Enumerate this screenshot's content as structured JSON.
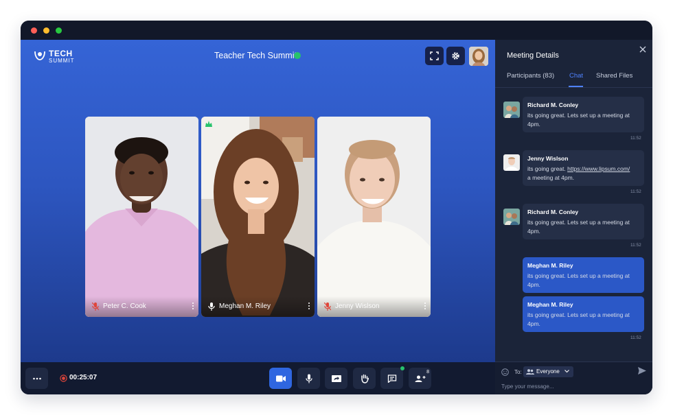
{
  "app": {
    "logo_line1": "TECH",
    "logo_line2": "SUMMIT",
    "meeting_title": "Teacher Tech Summit"
  },
  "participants_on_stage": [
    {
      "name": "Peter C. Cook",
      "mic": "muted"
    },
    {
      "name": "Meghan M. Riley",
      "mic": "on",
      "speaking": true
    },
    {
      "name": "Jenny Wislson",
      "mic": "muted"
    }
  ],
  "controls": {
    "timer": "00:25:07",
    "participants_badge": "8"
  },
  "panel": {
    "title": "Meeting Details",
    "tabs": [
      {
        "label": "Participants (83)",
        "active": false
      },
      {
        "label": "Chat",
        "active": true
      },
      {
        "label": "Shared Files",
        "active": false
      }
    ],
    "messages": [
      {
        "sender": "Richard M. Conley",
        "text": "its going great. Lets set up a meeting at 4pm.",
        "time": "11:52",
        "direction": "in"
      },
      {
        "sender": "Jenny Wislson",
        "text_before": "its going great. ",
        "link": "https://www.lipsum.com/",
        "text_after": "a meeting at 4pm.",
        "time": "11:52",
        "direction": "in"
      },
      {
        "sender": "Richard M. Conley",
        "text": "its going great. Lets set up a meeting at 4pm.",
        "time": "11:52",
        "direction": "in"
      },
      {
        "sender": "Meghan M. Riley",
        "text": "its going great. Lets set up a meeting at 4pm.",
        "direction": "out"
      },
      {
        "sender": "Meghan M. Riley",
        "text": "its going great. Lets set up a meeting at 4pm.",
        "time": "11:52",
        "direction": "out"
      }
    ],
    "composer": {
      "to_label": "To:",
      "audience": "Everyone",
      "placeholder": "Type your message..."
    }
  },
  "colors": {
    "accent": "#2f66e0",
    "live": "#27c26c",
    "muted": "#e0453a"
  }
}
